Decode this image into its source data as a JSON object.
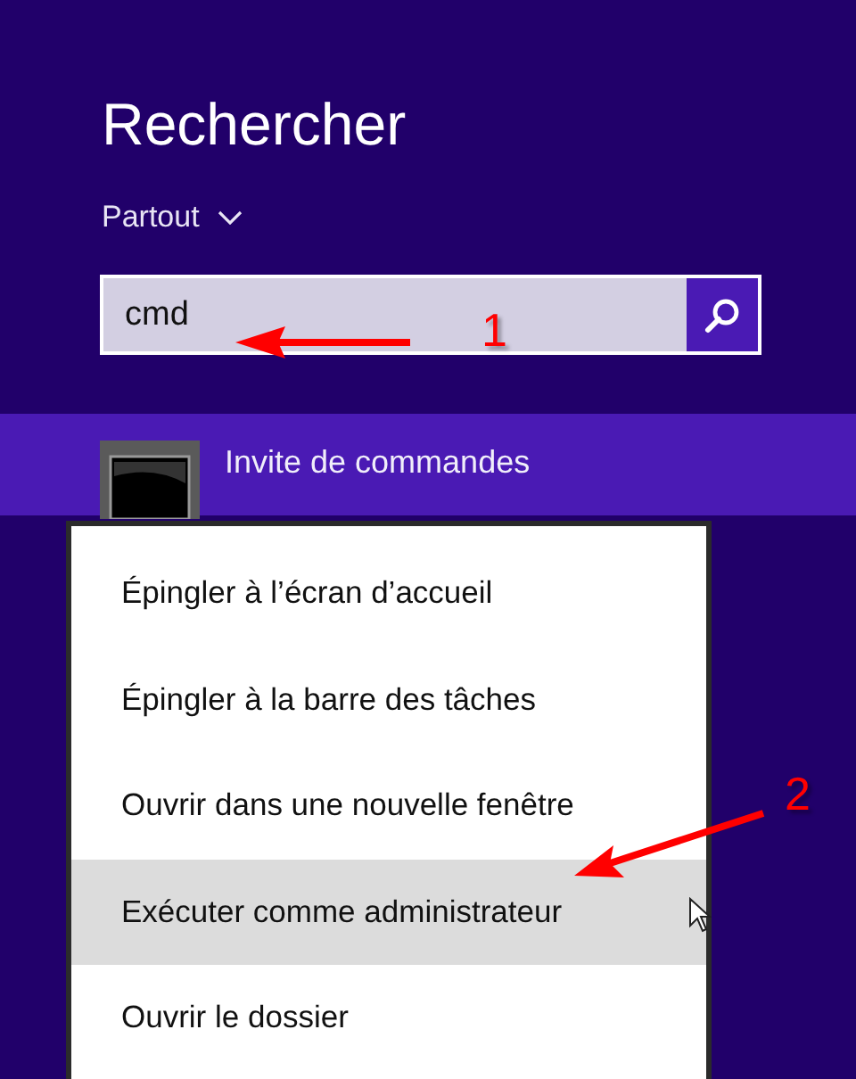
{
  "title": "Rechercher",
  "scope": {
    "label": "Partout"
  },
  "search": {
    "value": "cmd"
  },
  "results": [
    {
      "label": "Invite de commandes"
    }
  ],
  "context_menu": {
    "items": [
      {
        "label": "Épingler à l’écran d’accueil",
        "selected": false
      },
      {
        "label": "Épingler à la barre des tâches",
        "selected": false
      },
      {
        "label": "Ouvrir dans une nouvelle fenêtre",
        "selected": false
      },
      {
        "label": "Exécuter comme administrateur",
        "selected": true
      },
      {
        "label": "Ouvrir le dossier",
        "selected": false
      }
    ]
  },
  "annotations": [
    {
      "label": "1"
    },
    {
      "label": "2"
    }
  ]
}
